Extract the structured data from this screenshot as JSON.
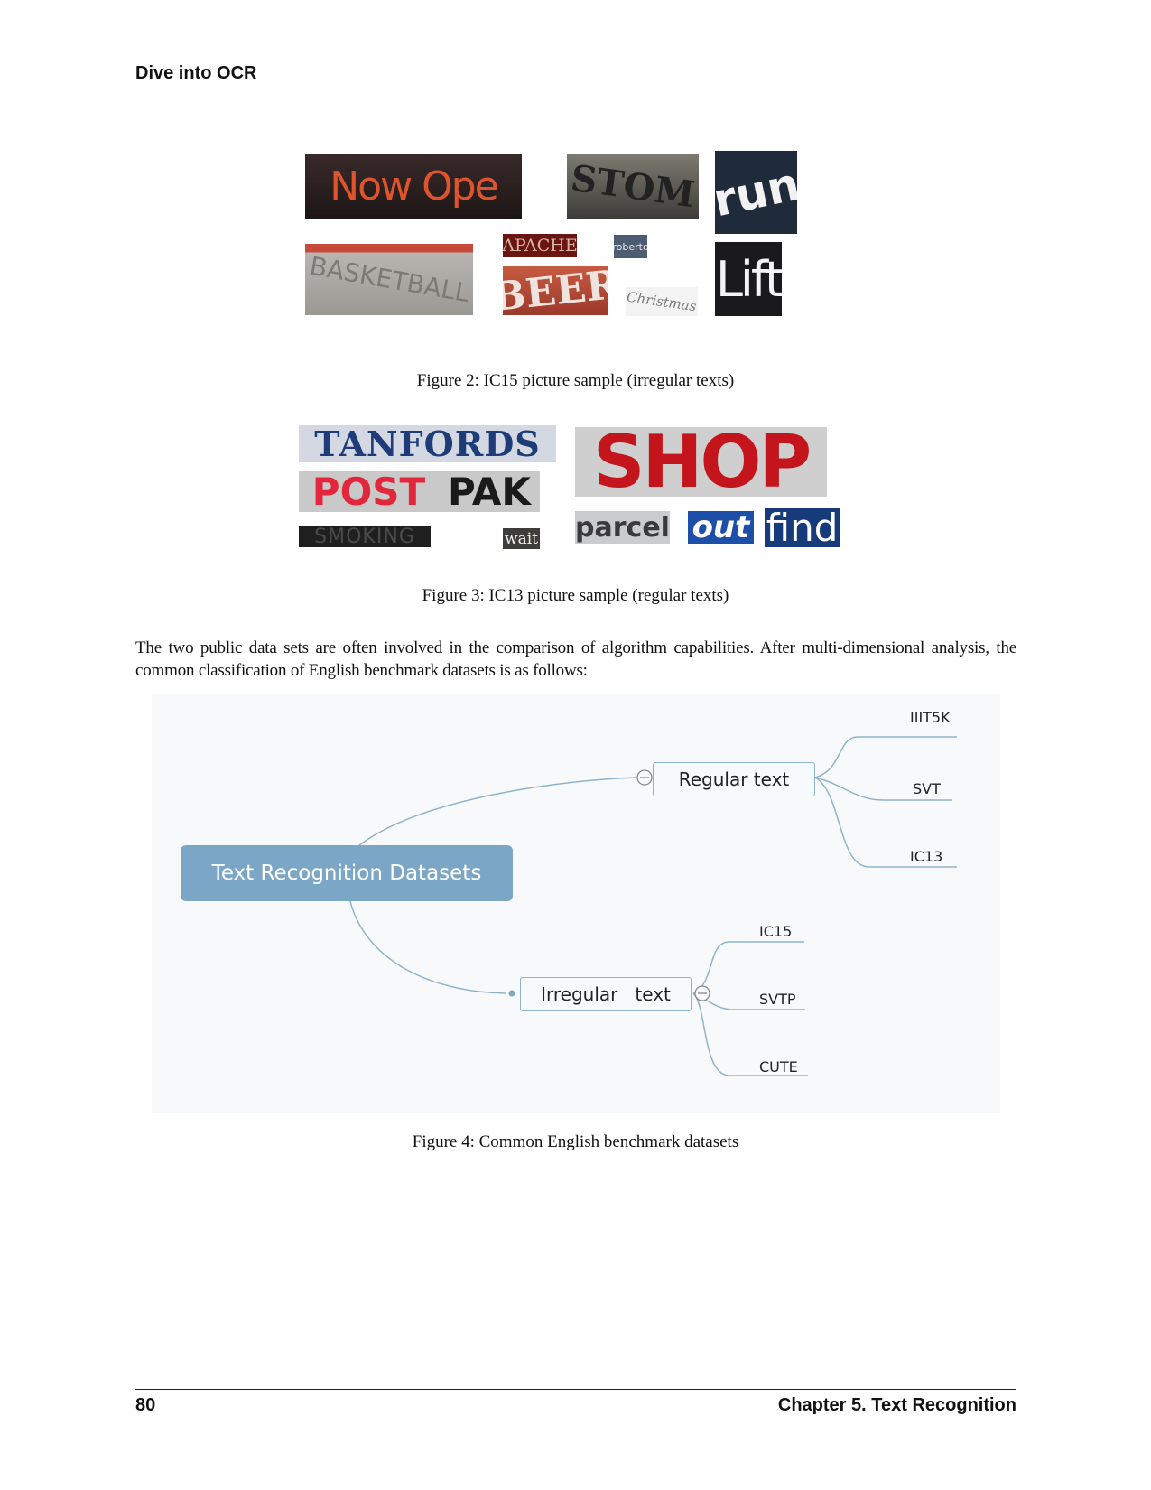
{
  "header": {
    "title": "Dive into OCR"
  },
  "figure2": {
    "samples": [
      "Now Ope",
      "STOM",
      "run",
      "BASKETBALL",
      "APACHE",
      "roberto",
      "BEER",
      "Christmas",
      "Lift"
    ],
    "caption": "Figure 2: IC15 picture sample (irregular texts)"
  },
  "figure3": {
    "samples": [
      "TANFORDS",
      "POST",
      "PAK",
      "SMOKING",
      "wait",
      "SHOP",
      "parcel",
      "out",
      "find"
    ],
    "caption": "Figure 3: IC13 picture sample (regular texts)"
  },
  "paragraph": "The two public data sets are often involved in the comparison of algorithm capabilities. After multi-dimensional analysis, the common classification of English benchmark datasets is as follows:",
  "figure4": {
    "root": "Text Recognition Datasets",
    "branches": [
      {
        "label": "Regular text",
        "children": [
          "IIIT5K",
          "SVT",
          "IC13"
        ]
      },
      {
        "label": "Irregular   text",
        "children": [
          "IC15",
          "SVTP",
          "CUTE"
        ]
      }
    ],
    "colors": {
      "root_fill": "#7ba6c5",
      "connector": "#8fb3cd"
    },
    "caption": "Figure 4: Common English benchmark datasets"
  },
  "footer": {
    "page_number": "80",
    "chapter": "Chapter 5.  Text Recognition"
  }
}
